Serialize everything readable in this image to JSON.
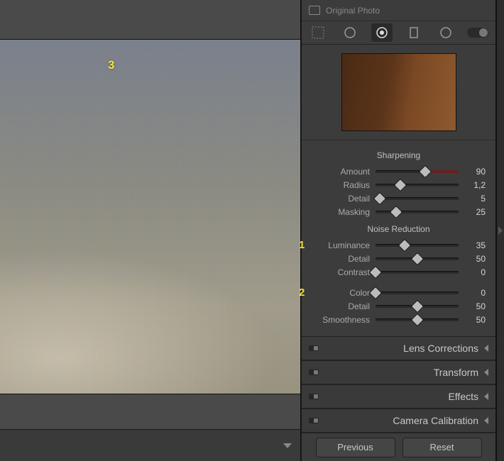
{
  "annotations": {
    "a1": "1",
    "a2": "2",
    "a3": "3"
  },
  "header": {
    "original_photo": "Original Photo"
  },
  "detail": {
    "sharpening": {
      "title": "Sharpening",
      "rows": [
        {
          "label": "Amount",
          "value": "90",
          "pos": 60,
          "redzone": 35
        },
        {
          "label": "Radius",
          "value": "1,2",
          "pos": 30,
          "redzone": 0
        },
        {
          "label": "Detail",
          "value": "5",
          "pos": 5,
          "redzone": 0
        },
        {
          "label": "Masking",
          "value": "25",
          "pos": 25,
          "redzone": 0
        }
      ]
    },
    "noise": {
      "title": "Noise Reduction",
      "rows": [
        {
          "label": "Luminance",
          "value": "35",
          "pos": 35,
          "marker": "a1"
        },
        {
          "label": "Detail",
          "value": "50",
          "pos": 50
        },
        {
          "label": "Contrast",
          "value": "0",
          "pos": 0
        }
      ],
      "color_rows": [
        {
          "label": "Color",
          "value": "0",
          "pos": 0,
          "marker": "a2"
        },
        {
          "label": "Detail",
          "value": "50",
          "pos": 50
        },
        {
          "label": "Smoothness",
          "value": "50",
          "pos": 50
        }
      ]
    }
  },
  "closed_panels": [
    {
      "name": "Lens Corrections"
    },
    {
      "name": "Transform"
    },
    {
      "name": "Effects"
    },
    {
      "name": "Camera Calibration"
    }
  ],
  "buttons": {
    "previous": "Previous",
    "reset": "Reset"
  }
}
